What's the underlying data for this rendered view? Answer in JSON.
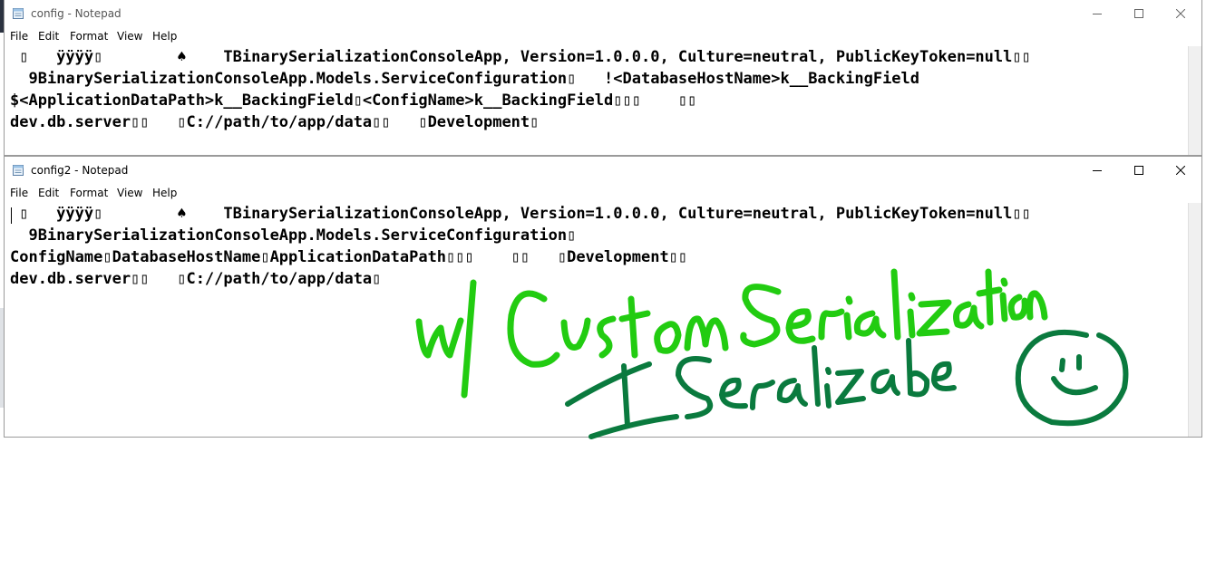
{
  "windows": [
    {
      "title": "config - Notepad",
      "menu": [
        "File",
        "Edit",
        "Format",
        "View",
        "Help"
      ],
      "lines": [
        " ▯   ÿÿÿÿ▯        ♠    TBinarySerializationConsoleApp, Version=1.0.0.0, Culture=neutral, PublicKeyToken=null▯▯",
        "  9BinarySerializationConsoleApp.Models.ServiceConfiguration▯   !<DatabaseHostName>k__BackingField",
        "$<ApplicationDataPath>k__BackingField▯<ConfigName>k__BackingField▯▯▯    ▯▯",
        "dev.db.server▯▯   ▯C://path/to/app/data▯▯   ▯Development▯"
      ]
    },
    {
      "title": "config2 - Notepad",
      "menu": [
        "File",
        "Edit",
        "Format",
        "View",
        "Help"
      ],
      "lines": [
        " ▯   ÿÿÿÿ▯        ♠    TBinarySerializationConsoleApp, Version=1.0.0.0, Culture=neutral, PublicKeyToken=null▯▯",
        "  9BinarySerializationConsoleApp.Models.ServiceConfiguration▯",
        "ConfigName▯DatabaseHostName▯ApplicationDataPath▯▯▯    ▯▯   ▯Development▯▯",
        "dev.db.server▯▯   ▯C://path/to/app/data▯"
      ]
    }
  ],
  "annotation": {
    "handwriting_line1": "w/ Custom Serialization",
    "handwriting_line2": "ISerializable",
    "icon": "smiley-face-icon",
    "color_light": "#22cc11",
    "color_dark": "#0a7a3e"
  }
}
